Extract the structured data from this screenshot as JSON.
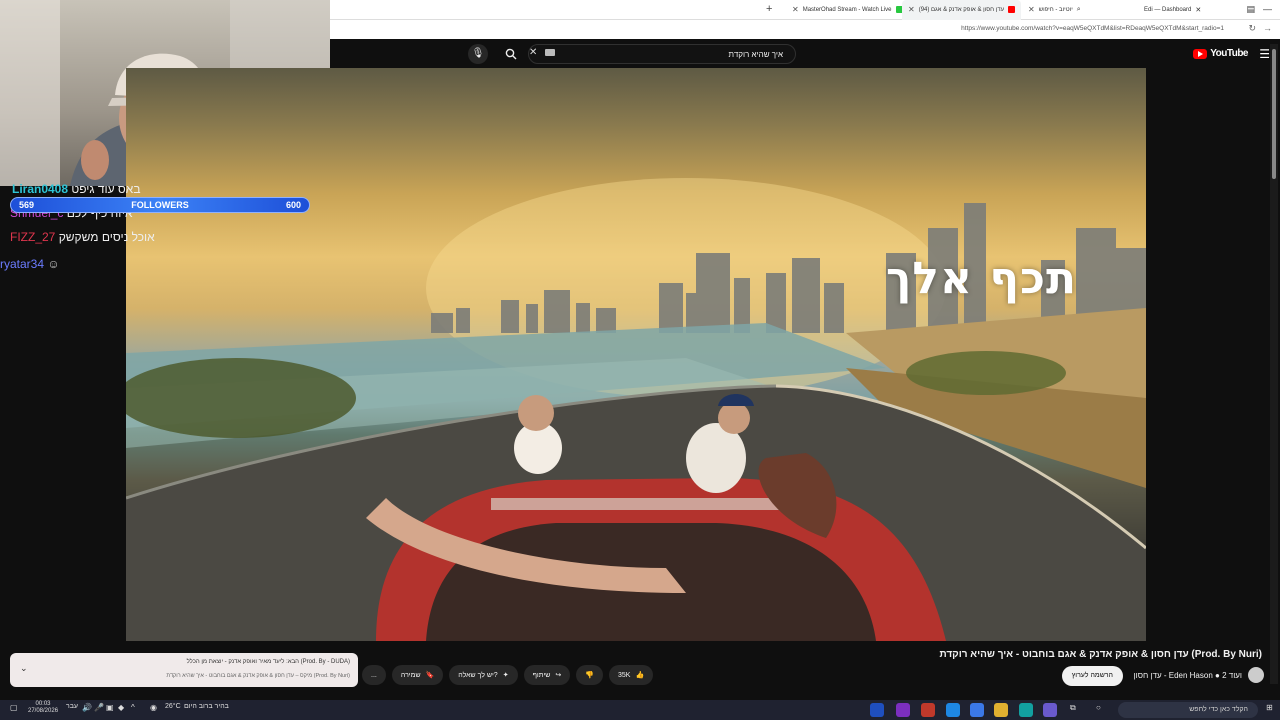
{
  "browser": {
    "tabs": [
      {
        "label": "MasterOhad Stream - Watch Live",
        "active": false
      },
      {
        "label": "(94) עדן חסון & אופק אדנק & אגם",
        "active": true
      },
      {
        "label": "יוטיוב - חיפוש",
        "active": false
      },
      {
        "label": "Edi — Dashboard",
        "active": false
      }
    ],
    "new_tab": "+",
    "url": "https://www.youtube.com/watch?v=eaqW5eQXTdM&list=RDeaqW5eQXTdM&start_radio=1"
  },
  "youtube": {
    "logo": "YouTube",
    "search_query": "איך שהיא רוקדת",
    "video_overlay_text": "תכף אלך",
    "video_title": "עדן חסון & אופק אדנק & אגם בוחבוט - איך שהיא רוקדת (Prod. By Nuri)",
    "channel_name": "עדן חסון - Eden Hason",
    "channel_extra": "ועוד 2",
    "subscribe_label": "הרשמה לערוץ",
    "likes": "35K",
    "share_label": "שיתוף",
    "ask_label": "יש לך שאלה?",
    "save_label": "שמירה",
    "more_label": "...",
    "playlist": {
      "line1": "הבא: ליעד מאיר ואופק אדנק - יוצאת מן הכלל (Prod. By - DUDA)",
      "line2": "מיקס – עדן חסון & אופק אדנק & אגם בוחבוט - איך שהיא רוקדת (Prod. By Nuri)"
    }
  },
  "stream": {
    "followers_label": "FOLLOWERS",
    "followers_current": "569",
    "followers_goal": "600",
    "followers_progress": 0.948,
    "chat": [
      {
        "user": "Liran0408",
        "message": "באס עוד גיפט",
        "color": "#2ec4d6"
      },
      {
        "user": "Shmuel_c",
        "message": "איזה כיף לכם",
        "color": "#d04ad9"
      },
      {
        "user": "FIZZ_27",
        "message": "אוכל ניסים משקשק",
        "color": "#e0364e"
      },
      {
        "user": "ryatar34",
        "message": "",
        "color": "#6b7cff"
      }
    ]
  },
  "taskbar": {
    "time": "00:03",
    "date": "27/08/2026",
    "lang": "עבר",
    "weather": "26°C",
    "weather_text": "בהיר ברוב היום",
    "search_placeholder": "הקלד כאן כדי לחפש"
  }
}
